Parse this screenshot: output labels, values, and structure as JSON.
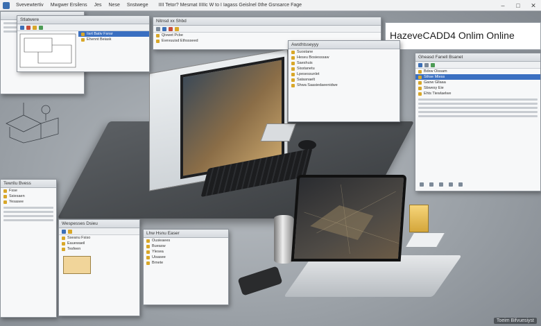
{
  "topbar": {
    "tabs": [
      "Svevewtertiv",
      "Mwgwer Ersilens",
      "Jes",
      "Nese",
      "Snstwege"
    ],
    "title": "IIII Tetor? Mesmat IIIIIc W to  I Iagass Geislnel 0the Gsnsarce Fage"
  },
  "window_controls": [
    "–",
    "□",
    "✕"
  ],
  "main_title": "HazeveCADD4 Onlim Online",
  "windows": {
    "top_left": {
      "title": "Stlatwere",
      "rows": [
        "Iisrt Bativ Fsnsr",
        "Ehennt Beiask"
      ]
    },
    "top_mid": {
      "title": "Nitnsd xx Shbd",
      "rows": [
        "Qivwet Pcbe",
        "Evevuuisd Ethssseed"
      ]
    },
    "center_right": {
      "title": "Awsthtsseyyy",
      "rows": [
        "Suostane",
        "Heseu Bosiesssaw",
        "Saeshuis",
        "Sisstanetu",
        "Lpesessunlet",
        "Satasnaelt",
        "Shwa Saasiedaeenidwe"
      ]
    },
    "right": {
      "title": "Gheasd Fanell Bsanet",
      "rows": [
        "Bdxw Oissam",
        "Sthse Mtess",
        "Gaow Gllaaa",
        "Sbwesy Eie",
        "Ehts Tiewlaelwe"
      ]
    },
    "bottom_left": {
      "title": "Tewrilu Bvess",
      "rows": [
        "Fsse",
        "Ssiesaen",
        "Yesasee"
      ]
    },
    "bottom_mid": {
      "title": "Wespesses Dsieu",
      "rows": [
        "Sseanu Fsiso",
        "Eauewaeil",
        "Tesfeen"
      ]
    },
    "bottom_mid2": {
      "title": "Lhw Hsnu Easer",
      "rows": [
        "Ousieaees",
        "Bueasw",
        "Ylesea",
        "Uisasee",
        "Brnete"
      ]
    }
  },
  "watermark": "Toeim Bifvuesiyst"
}
